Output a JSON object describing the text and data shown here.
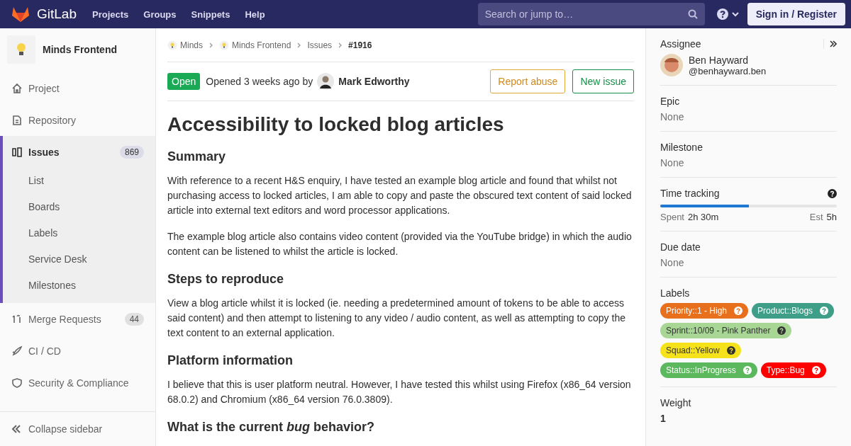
{
  "header": {
    "brand": "GitLab",
    "nav": [
      "Projects",
      "Groups",
      "Snippets",
      "Help"
    ],
    "search": {
      "placeholder": "Search or jump to…"
    },
    "sign_in": "Sign in / Register"
  },
  "sidebar": {
    "project": "Minds Frontend",
    "items": [
      {
        "label": "Project",
        "selected": false
      },
      {
        "label": "Repository",
        "selected": false
      },
      {
        "label": "Issues",
        "count": "869",
        "selected": true,
        "children": [
          {
            "label": "List"
          },
          {
            "label": "Boards"
          },
          {
            "label": "Labels"
          },
          {
            "label": "Service Desk"
          },
          {
            "label": "Milestones"
          }
        ]
      },
      {
        "label": "Merge Requests",
        "count": "44",
        "selected": false
      },
      {
        "label": "CI / CD",
        "selected": false
      },
      {
        "label": "Security & Compliance",
        "selected": false
      }
    ],
    "collapse": "Collapse sidebar"
  },
  "breadcrumb": [
    "Minds",
    "Minds Frontend",
    "Issues",
    "#1916"
  ],
  "issue": {
    "status": "Open",
    "opened": "Opened 3 weeks ago by",
    "author": "Mark Edworthy",
    "buttons": [
      {
        "label": "Report abuse",
        "kind": "warning"
      },
      {
        "label": "New issue",
        "kind": "success"
      }
    ],
    "title": "Accessibility to locked blog articles",
    "body": [
      {
        "kind": "heading",
        "text": "Summary"
      },
      {
        "kind": "paragraph",
        "text": "With reference to a recent H&S enquiry, I have tested an example blog article and found that whilst not purchasing access to locked articles, I am able to copy and paste the obscured text content of said locked article into external text editors and word processor applications."
      },
      {
        "kind": "paragraph",
        "text": "The example blog article also contains video content (provided via the YouTube bridge) in which the audio content can be listened to whilst the article is locked."
      },
      {
        "kind": "heading",
        "text": "Steps to reproduce"
      },
      {
        "kind": "paragraph",
        "text": "View a blog article whilst it is locked (ie. needing a predetermined amount of tokens to be able to access said content) and then attempt to listening to any video / audio content, as well as attempting to copy the text content to an external application."
      },
      {
        "kind": "heading",
        "text": "Platform information"
      },
      {
        "kind": "paragraph",
        "text": "I believe that this is user platform neutral. However, I have tested this whilst using Firefox (x86_64 version 68.0.2) and Chromium (x86_64 version 76.0.3809)."
      },
      {
        "kind": "heading",
        "text": "What is the current *bug* behavior?"
      }
    ]
  },
  "right": {
    "assignee": {
      "title": "Assignee",
      "name": "Ben Hayward",
      "handle": "@benhayward.ben"
    },
    "epic": {
      "title": "Epic",
      "value": "None"
    },
    "milestone": {
      "title": "Milestone",
      "value": "None"
    },
    "time": {
      "title": "Time tracking",
      "level": 0.5,
      "spent_label": "Spent",
      "spent": "2h 30m",
      "est_label": "Est",
      "est": "5h"
    },
    "due": {
      "title": "Due date",
      "value": "None"
    },
    "labels_title": "Labels",
    "labels": [
      {
        "text": "Priority::1 - High",
        "color": "#e8701d"
      },
      {
        "text": "Product::Blogs",
        "color": "#3f9e88"
      },
      {
        "text": "Sprint::10/09 - Pink Panther",
        "color": "#a8d695"
      },
      {
        "text": "Squad::Yellow",
        "color": "#f5e21b"
      },
      {
        "text": "Status::InProgress",
        "color": "#5cb85c"
      },
      {
        "text": "Type::Bug",
        "color": "#ff0000"
      }
    ],
    "weight": {
      "title": "Weight",
      "value": "1"
    }
  }
}
